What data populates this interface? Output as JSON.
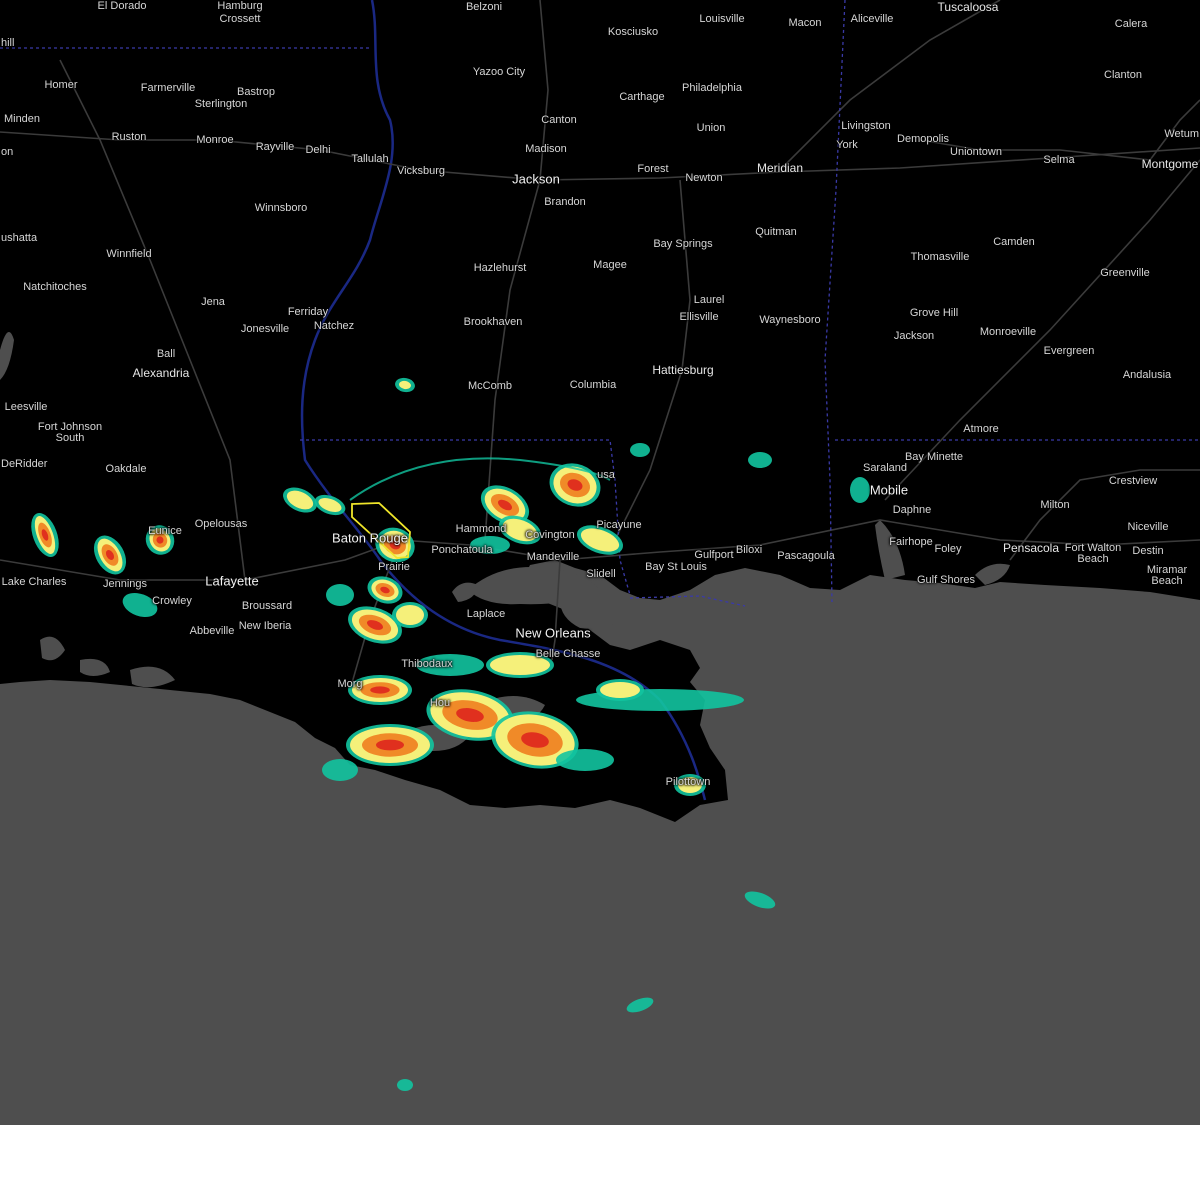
{
  "map": {
    "colors": {
      "land": "#000000",
      "water": "#4e4e4e",
      "state_border": "#3a3aa8",
      "roads": "#3b3b3b",
      "warning_polygon": "#f0e62a",
      "radar_light": "#12c4a0",
      "radar_medium": "#f5f07a",
      "radar_heavy": "#f08a28",
      "radar_intense": "#e0301e"
    },
    "icons": {
      "warning_polygon": "warning-polygon-outline"
    },
    "cities": [
      {
        "id": "el-dorado",
        "label": "El Dorado"
      },
      {
        "id": "hamburg",
        "label": "Hamburg"
      },
      {
        "id": "crossett",
        "label": "Crossett"
      },
      {
        "id": "belzoni",
        "label": "Belzoni"
      },
      {
        "id": "kosciusko",
        "label": "Kosciusko"
      },
      {
        "id": "louisville",
        "label": "Louisville"
      },
      {
        "id": "macon",
        "label": "Macon"
      },
      {
        "id": "aliceville",
        "label": "Aliceville"
      },
      {
        "id": "tuscaloosa",
        "label": "Tuscaloosa"
      },
      {
        "id": "calera",
        "label": "Calera"
      },
      {
        "id": "hill",
        "label": "hill"
      },
      {
        "id": "yazoo-city",
        "label": "Yazoo City"
      },
      {
        "id": "clanton",
        "label": "Clanton"
      },
      {
        "id": "homer",
        "label": "Homer"
      },
      {
        "id": "farmerville",
        "label": "Farmerville"
      },
      {
        "id": "bastrop",
        "label": "Bastrop"
      },
      {
        "id": "sterlington",
        "label": "Sterlington"
      },
      {
        "id": "philadelphia",
        "label": "Philadelphia"
      },
      {
        "id": "carthage",
        "label": "Carthage"
      },
      {
        "id": "minden",
        "label": "Minden"
      },
      {
        "id": "canton",
        "label": "Canton"
      },
      {
        "id": "livingston",
        "label": "Livingston"
      },
      {
        "id": "union",
        "label": "Union"
      },
      {
        "id": "wetumpka",
        "label": "Wetum"
      },
      {
        "id": "ruston",
        "label": "Ruston"
      },
      {
        "id": "monroe",
        "label": "Monroe"
      },
      {
        "id": "rayville",
        "label": "Rayville"
      },
      {
        "id": "delhi",
        "label": "Delhi"
      },
      {
        "id": "demopolis",
        "label": "Demopolis"
      },
      {
        "id": "madison",
        "label": "Madison"
      },
      {
        "id": "york",
        "label": "York"
      },
      {
        "id": "tallulah",
        "label": "Tallulah"
      },
      {
        "id": "uniontown",
        "label": "Uniontown"
      },
      {
        "id": "selma",
        "label": "Selma"
      },
      {
        "id": "montgomery",
        "label": "Montgome"
      },
      {
        "id": "on-edge",
        "label": "on"
      },
      {
        "id": "forest",
        "label": "Forest"
      },
      {
        "id": "meridian",
        "label": "Meridian"
      },
      {
        "id": "vicksburg",
        "label": "Vicksburg"
      },
      {
        "id": "jackson-ms",
        "label": "Jackson"
      },
      {
        "id": "newton",
        "label": "Newton"
      },
      {
        "id": "brandon",
        "label": "Brandon"
      },
      {
        "id": "winnsboro",
        "label": "Winnsboro"
      },
      {
        "id": "quitman",
        "label": "Quitman"
      },
      {
        "id": "camden",
        "label": "Camden"
      },
      {
        "id": "bay-springs",
        "label": "Bay Springs"
      },
      {
        "id": "ushatta",
        "label": "ushatta"
      },
      {
        "id": "winnfield",
        "label": "Winnfield"
      },
      {
        "id": "thomasville",
        "label": "Thomasville"
      },
      {
        "id": "hazlehurst",
        "label": "Hazlehurst"
      },
      {
        "id": "magee",
        "label": "Magee"
      },
      {
        "id": "greenville-al",
        "label": "Greenville"
      },
      {
        "id": "natchitoches",
        "label": "Natchitoches"
      },
      {
        "id": "laurel",
        "label": "Laurel"
      },
      {
        "id": "jena",
        "label": "Jena"
      },
      {
        "id": "ferriday",
        "label": "Ferriday"
      },
      {
        "id": "grove-hill",
        "label": "Grove Hill"
      },
      {
        "id": "ellisville",
        "label": "Ellisville"
      },
      {
        "id": "brookhaven",
        "label": "Brookhaven"
      },
      {
        "id": "waynesboro",
        "label": "Waynesboro"
      },
      {
        "id": "jonesville",
        "label": "Jonesville"
      },
      {
        "id": "natchez",
        "label": "Natchez"
      },
      {
        "id": "monroeville",
        "label": "Monroeville"
      },
      {
        "id": "jackson-al",
        "label": "Jackson"
      },
      {
        "id": "ball",
        "label": "Ball"
      },
      {
        "id": "evergreen",
        "label": "Evergreen"
      },
      {
        "id": "alexandria",
        "label": "Alexandria"
      },
      {
        "id": "hattiesburg",
        "label": "Hattiesburg"
      },
      {
        "id": "andalusia",
        "label": "Andalusia"
      },
      {
        "id": "mccomb",
        "label": "McComb"
      },
      {
        "id": "columbia",
        "label": "Columbia"
      },
      {
        "id": "leesville",
        "label": "Leesville"
      },
      {
        "id": "atmore",
        "label": "Atmore"
      },
      {
        "id": "fort-johnson-south",
        "label": "Fort Johnson\nSouth"
      },
      {
        "id": "bay-minette",
        "label": "Bay Minette"
      },
      {
        "id": "deridder",
        "label": "DeRidder"
      },
      {
        "id": "oakdale",
        "label": "Oakdale"
      },
      {
        "id": "bogalusa",
        "label": "usa"
      },
      {
        "id": "saraland",
        "label": "Saraland"
      },
      {
        "id": "crestview",
        "label": "Crestview"
      },
      {
        "id": "mobile",
        "label": "Mobile"
      },
      {
        "id": "hammond",
        "label": "Hammond"
      },
      {
        "id": "opelousas",
        "label": "Opelousas"
      },
      {
        "id": "covington",
        "label": "Covington"
      },
      {
        "id": "picayune",
        "label": "Picayune"
      },
      {
        "id": "daphne",
        "label": "Daphne"
      },
      {
        "id": "milton",
        "label": "Milton"
      },
      {
        "id": "eunice",
        "label": "Eunice"
      },
      {
        "id": "baton-rouge",
        "label": "Baton Rouge"
      },
      {
        "id": "niceville",
        "label": "Niceville"
      },
      {
        "id": "fairhope",
        "label": "Fairhope"
      },
      {
        "id": "foley",
        "label": "Foley"
      },
      {
        "id": "ponchatoula",
        "label": "Ponchatoula"
      },
      {
        "id": "mandeville",
        "label": "Mandeville"
      },
      {
        "id": "gulfport",
        "label": "Gulfport"
      },
      {
        "id": "biloxi",
        "label": "Biloxi"
      },
      {
        "id": "pensacola",
        "label": "Pensacola"
      },
      {
        "id": "fort-walton-beach",
        "label": "Fort Walton\nBeach"
      },
      {
        "id": "destin",
        "label": "Destin"
      },
      {
        "id": "pascagoula",
        "label": "Pascagoula"
      },
      {
        "id": "bay-st-louis",
        "label": "Bay St Louis"
      },
      {
        "id": "slidell",
        "label": "Slidell"
      },
      {
        "id": "prairieville",
        "label": "Prairie"
      },
      {
        "id": "gulf-shores",
        "label": "Gulf Shores"
      },
      {
        "id": "miramar-beach",
        "label": "Miramar\nBeach"
      },
      {
        "id": "lake-charles",
        "label": "Lake Charles"
      },
      {
        "id": "jennings",
        "label": "Jennings"
      },
      {
        "id": "lafayette",
        "label": "Lafayette"
      },
      {
        "id": "crowley",
        "label": "Crowley"
      },
      {
        "id": "broussard",
        "label": "Broussard"
      },
      {
        "id": "laplace",
        "label": "Laplace"
      },
      {
        "id": "new-iberia",
        "label": "New Iberia"
      },
      {
        "id": "abbeville",
        "label": "Abbeville"
      },
      {
        "id": "new-orleans",
        "label": "New Orleans"
      },
      {
        "id": "belle-chasse",
        "label": "Belle Chasse"
      },
      {
        "id": "thibodaux",
        "label": "Thibodaux"
      },
      {
        "id": "morgan-city",
        "label": "Morg"
      },
      {
        "id": "houma",
        "label": "Hou"
      },
      {
        "id": "pilottown",
        "label": "Pilottown"
      }
    ]
  }
}
